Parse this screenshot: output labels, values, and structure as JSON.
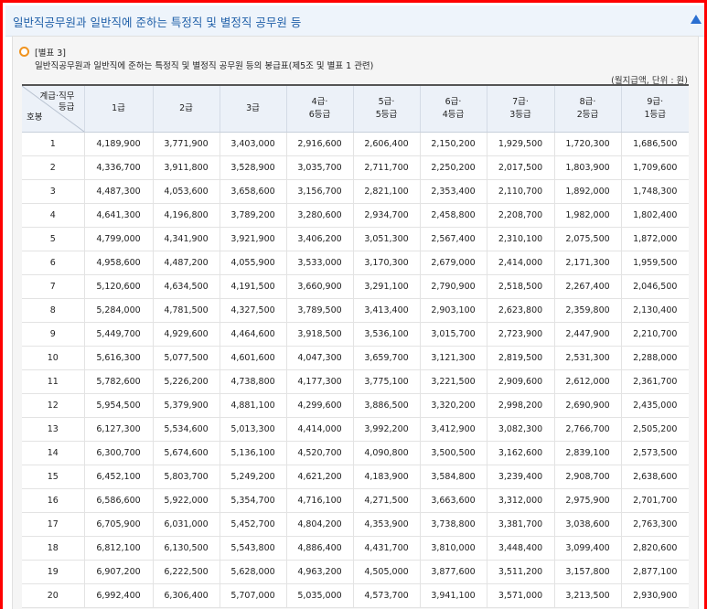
{
  "header": {
    "title": "일반직공무원과 일반직에 준하는 특정직 및 별정직 공무원 등"
  },
  "section": {
    "table_ref": "[별표 3]",
    "caption": "일반직공무원과 일반직에 준하는 특정직 및 별정직 공무원 등의 봉급표(제5조 및 별표 1 관련)",
    "unit": "(월지급액, 단위 : 원)"
  },
  "table": {
    "corner_top_line1": "계급·직무",
    "corner_top_line2": "등급",
    "corner_bottom": "호봉",
    "columns": [
      [
        "1급"
      ],
      [
        "2급"
      ],
      [
        "3급"
      ],
      [
        "4급·",
        "6등급"
      ],
      [
        "5급·",
        "5등급"
      ],
      [
        "6급·",
        "4등급"
      ],
      [
        "7급·",
        "3등급"
      ],
      [
        "8급·",
        "2등급"
      ],
      [
        "9급·",
        "1등급"
      ]
    ],
    "rows": [
      [
        "1",
        "4,189,900",
        "3,771,900",
        "3,403,000",
        "2,916,600",
        "2,606,400",
        "2,150,200",
        "1,929,500",
        "1,720,300",
        "1,686,500"
      ],
      [
        "2",
        "4,336,700",
        "3,911,800",
        "3,528,900",
        "3,035,700",
        "2,711,700",
        "2,250,200",
        "2,017,500",
        "1,803,900",
        "1,709,600"
      ],
      [
        "3",
        "4,487,300",
        "4,053,600",
        "3,658,600",
        "3,156,700",
        "2,821,100",
        "2,353,400",
        "2,110,700",
        "1,892,000",
        "1,748,300"
      ],
      [
        "4",
        "4,641,300",
        "4,196,800",
        "3,789,200",
        "3,280,600",
        "2,934,700",
        "2,458,800",
        "2,208,700",
        "1,982,000",
        "1,802,400"
      ],
      [
        "5",
        "4,799,000",
        "4,341,900",
        "3,921,900",
        "3,406,200",
        "3,051,300",
        "2,567,400",
        "2,310,100",
        "2,075,500",
        "1,872,000"
      ],
      [
        "6",
        "4,958,600",
        "4,487,200",
        "4,055,900",
        "3,533,000",
        "3,170,300",
        "2,679,000",
        "2,414,000",
        "2,171,300",
        "1,959,500"
      ],
      [
        "7",
        "5,120,600",
        "4,634,500",
        "4,191,500",
        "3,660,900",
        "3,291,100",
        "2,790,900",
        "2,518,500",
        "2,267,400",
        "2,046,500"
      ],
      [
        "8",
        "5,284,000",
        "4,781,500",
        "4,327,500",
        "3,789,500",
        "3,413,400",
        "2,903,100",
        "2,623,800",
        "2,359,800",
        "2,130,400"
      ],
      [
        "9",
        "5,449,700",
        "4,929,600",
        "4,464,600",
        "3,918,500",
        "3,536,100",
        "3,015,700",
        "2,723,900",
        "2,447,900",
        "2,210,700"
      ],
      [
        "10",
        "5,616,300",
        "5,077,500",
        "4,601,600",
        "4,047,300",
        "3,659,700",
        "3,121,300",
        "2,819,500",
        "2,531,300",
        "2,288,000"
      ],
      [
        "11",
        "5,782,600",
        "5,226,200",
        "4,738,800",
        "4,177,300",
        "3,775,100",
        "3,221,500",
        "2,909,600",
        "2,612,000",
        "2,361,700"
      ],
      [
        "12",
        "5,954,500",
        "5,379,900",
        "4,881,100",
        "4,299,600",
        "3,886,500",
        "3,320,200",
        "2,998,200",
        "2,690,900",
        "2,435,000"
      ],
      [
        "13",
        "6,127,300",
        "5,534,600",
        "5,013,300",
        "4,414,000",
        "3,992,200",
        "3,412,900",
        "3,082,300",
        "2,766,700",
        "2,505,200"
      ],
      [
        "14",
        "6,300,700",
        "5,674,600",
        "5,136,100",
        "4,520,700",
        "4,090,800",
        "3,500,500",
        "3,162,600",
        "2,839,100",
        "2,573,500"
      ],
      [
        "15",
        "6,452,100",
        "5,803,700",
        "5,249,200",
        "4,621,200",
        "4,183,900",
        "3,584,800",
        "3,239,400",
        "2,908,700",
        "2,638,600"
      ],
      [
        "16",
        "6,586,600",
        "5,922,000",
        "5,354,700",
        "4,716,100",
        "4,271,500",
        "3,663,600",
        "3,312,000",
        "2,975,900",
        "2,701,700"
      ],
      [
        "17",
        "6,705,900",
        "6,031,000",
        "5,452,700",
        "4,804,200",
        "4,353,900",
        "3,738,800",
        "3,381,700",
        "3,038,600",
        "2,763,300"
      ],
      [
        "18",
        "6,812,100",
        "6,130,500",
        "5,543,800",
        "4,886,400",
        "4,431,700",
        "3,810,000",
        "3,448,400",
        "3,099,400",
        "2,820,600"
      ],
      [
        "19",
        "6,907,200",
        "6,222,500",
        "5,628,000",
        "4,963,200",
        "4,505,000",
        "3,877,600",
        "3,511,200",
        "3,157,800",
        "2,877,100"
      ],
      [
        "20",
        "6,992,400",
        "6,306,400",
        "5,707,000",
        "5,035,000",
        "4,573,700",
        "3,941,100",
        "3,571,000",
        "3,213,500",
        "2,930,900"
      ]
    ]
  },
  "colors": {
    "frame_border": "#ff0000",
    "title_text": "#1f5fa8",
    "bullet": "#f0931e",
    "header_cell_bg": "#ecf1f8",
    "collapse_arrow": "#2a6fd1"
  },
  "icons": {
    "bullet": "circle-bullet-icon",
    "collapse": "triangle-up-icon"
  }
}
